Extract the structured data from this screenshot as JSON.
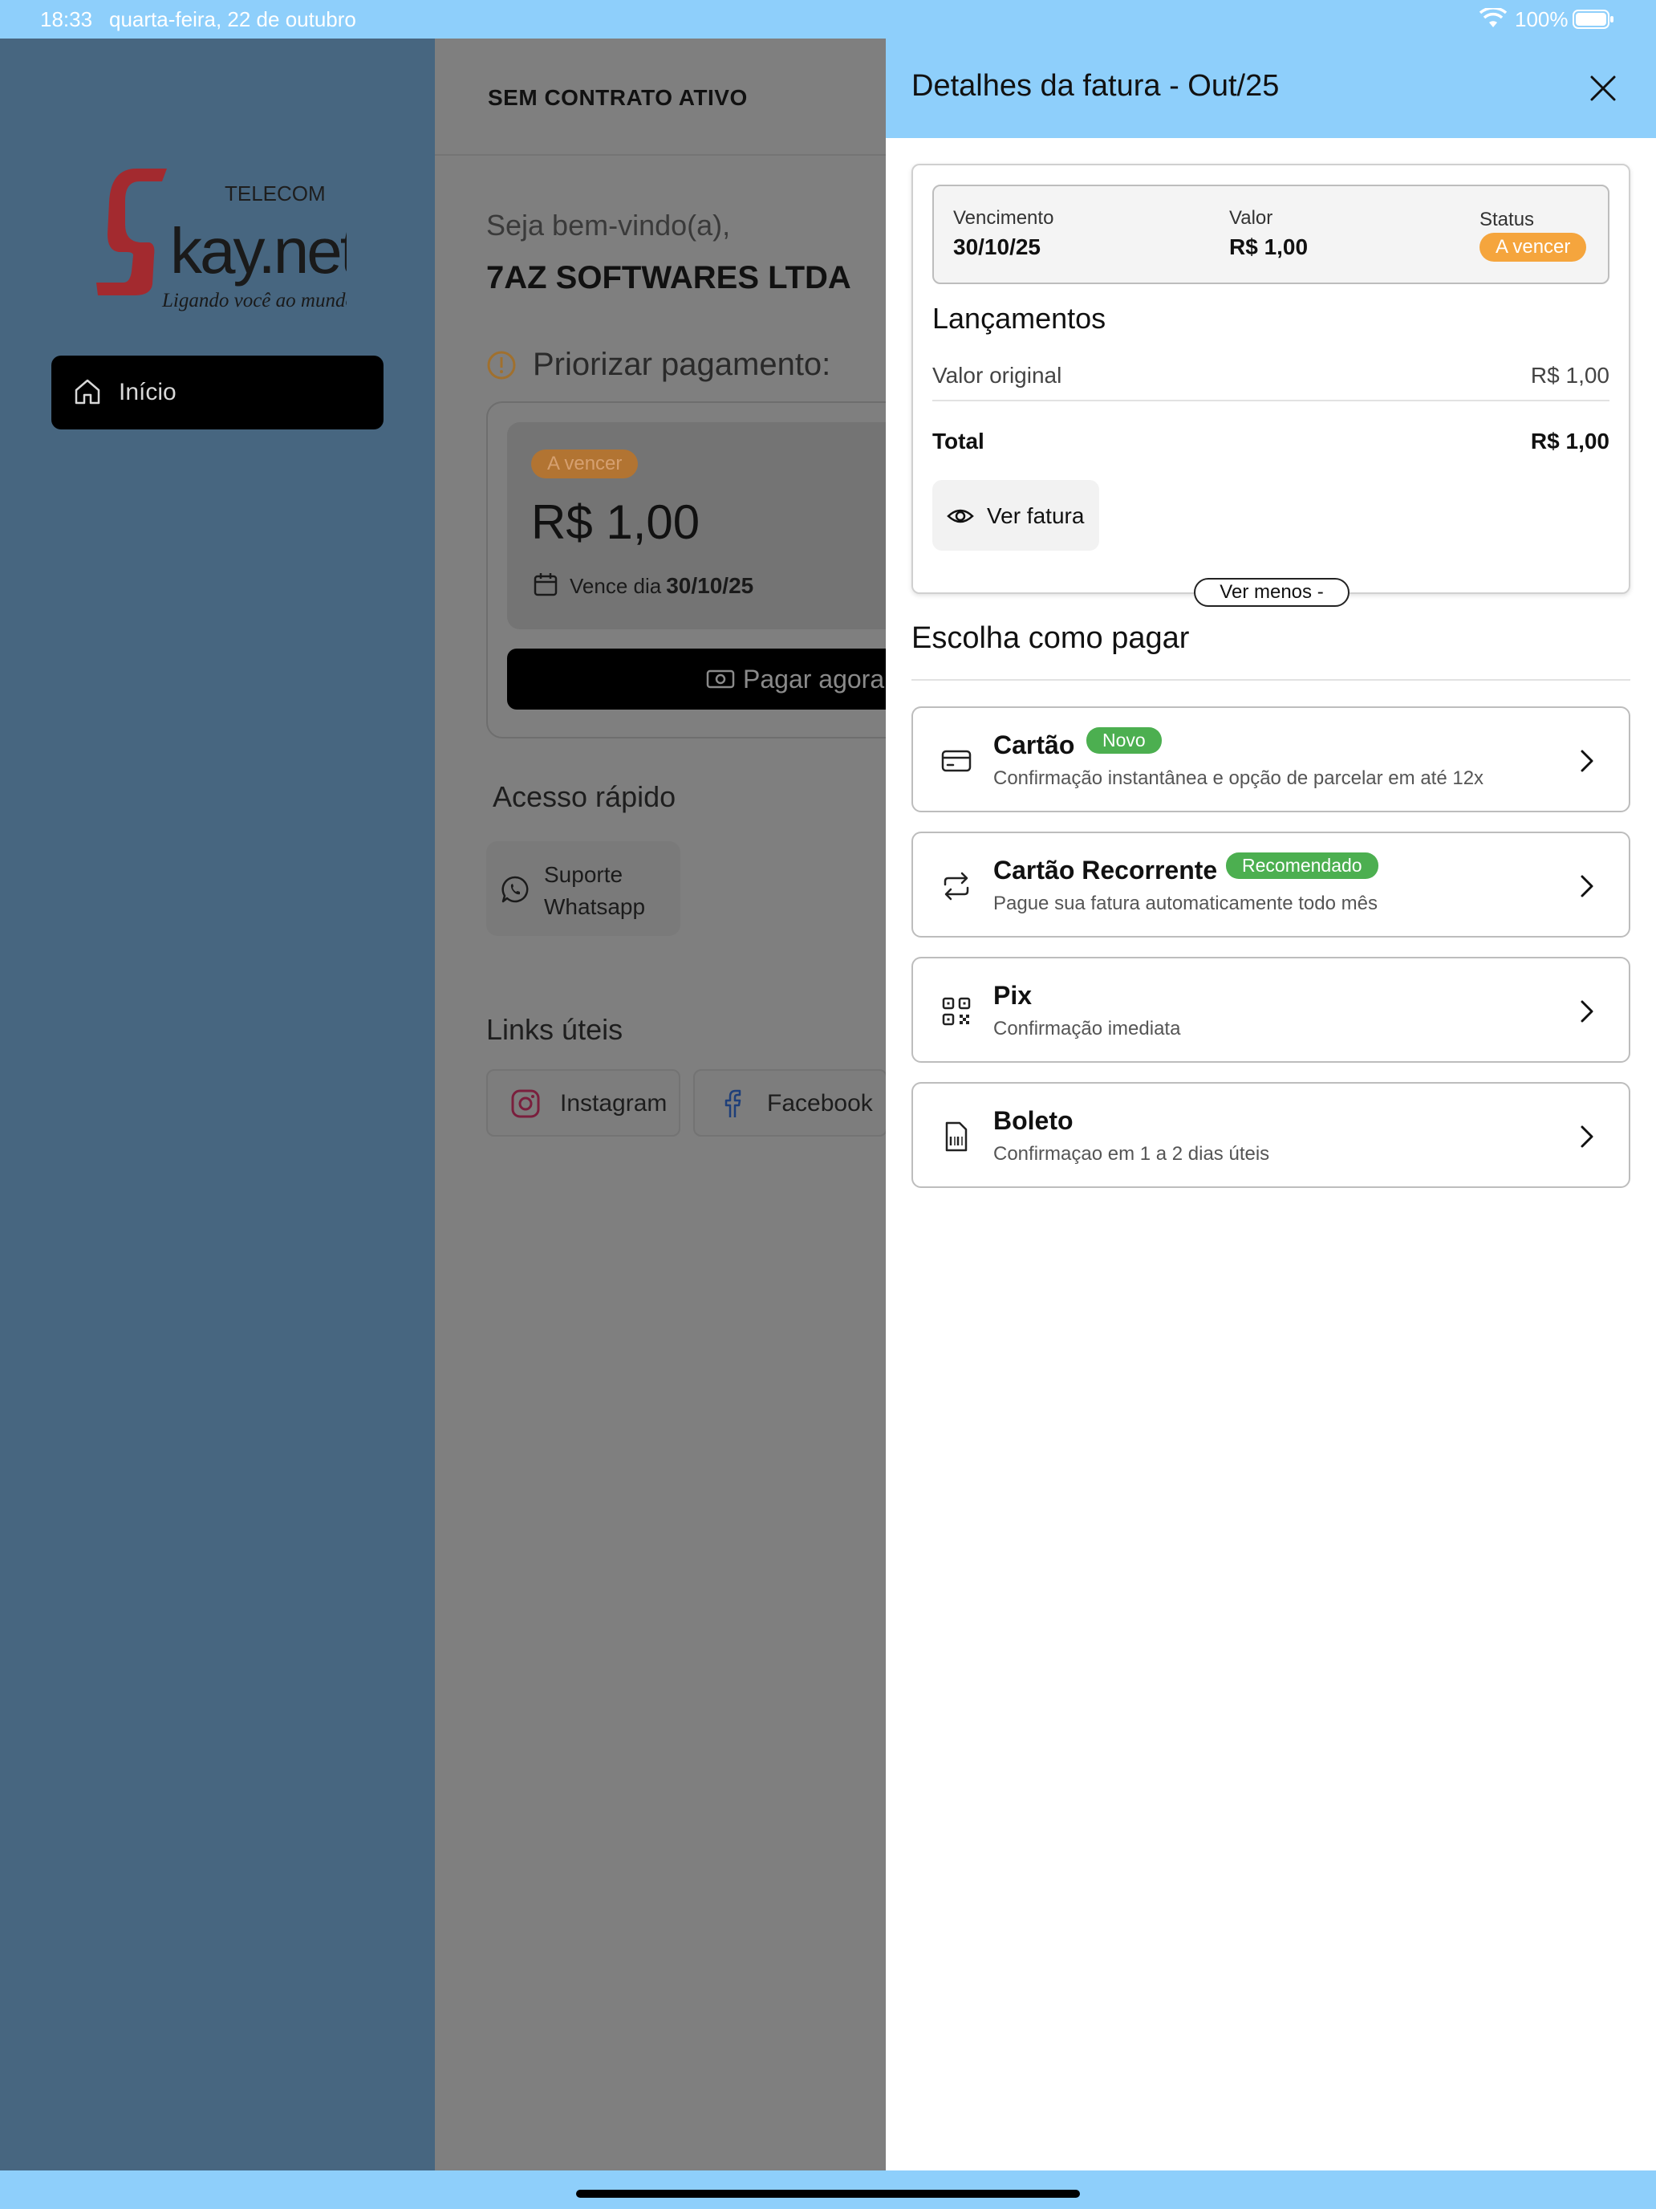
{
  "status_bar": {
    "time": "18:33",
    "date": "quarta-feira, 22 de outubro",
    "battery": "100%"
  },
  "sidebar": {
    "logo": {
      "brand": "kay.net",
      "tagline": "Ligando você ao mundo!",
      "sub": "TELECOM"
    },
    "items": [
      {
        "label": "Início",
        "icon": "home-icon",
        "active": true
      }
    ]
  },
  "main": {
    "header_title": "SEM CONTRATO ATIVO",
    "welcome": "Seja bem-vindo(a),",
    "company": "7AZ SOFTWARES LTDA",
    "priority_title": "Priorizar pagamento:",
    "invoice": {
      "badge": "A vencer",
      "amount": "R$ 1,00",
      "due_prefix": "Vence dia",
      "due_date": "30/10/25",
      "pay_button": "Pagar agora"
    },
    "quick_access_title": "Acesso rápido",
    "quick_access": [
      {
        "label": "Suporte Whatsapp",
        "icon": "whatsapp-icon"
      }
    ],
    "links_title": "Links úteis",
    "links": [
      {
        "label": "Instagram",
        "icon": "instagram-icon"
      },
      {
        "label": "Facebook",
        "icon": "facebook-icon"
      }
    ]
  },
  "drawer": {
    "title": "Detalhes da fatura - Out/25",
    "summary": {
      "vencimento_label": "Vencimento",
      "vencimento_value": "30/10/25",
      "valor_label": "Valor",
      "valor_value": "R$ 1,00",
      "status_label": "Status",
      "status_value": "A vencer"
    },
    "lancamentos_title": "Lançamentos",
    "lancamentos": [
      {
        "label": "Valor original",
        "value": "R$ 1,00"
      }
    ],
    "total_label": "Total",
    "total_value": "R$ 1,00",
    "ver_fatura": "Ver fatura",
    "ver_menos": "Ver menos -",
    "choose_title": "Escolha como pagar",
    "options": [
      {
        "name": "Cartão",
        "badge": "Novo",
        "desc": "Confirmação instantânea e opção de parcelar em até 12x",
        "icon": "credit-card-icon"
      },
      {
        "name": "Cartão Recorrente",
        "badge": "Recomendado",
        "desc": "Pague sua fatura automaticamente todo mês",
        "icon": "repeat-icon"
      },
      {
        "name": "Pix",
        "badge": "",
        "desc": "Confirmação imediata",
        "icon": "qr-code-icon"
      },
      {
        "name": "Boleto",
        "badge": "",
        "desc": "Confirmaçao em 1 a 2 dias úteis",
        "icon": "barcode-document-icon"
      }
    ]
  },
  "colors": {
    "accent_blue": "#8ecffb",
    "badge_orange": "#f5a53d",
    "badge_green": "#4caf50",
    "sidebar_bg": "#476680"
  }
}
